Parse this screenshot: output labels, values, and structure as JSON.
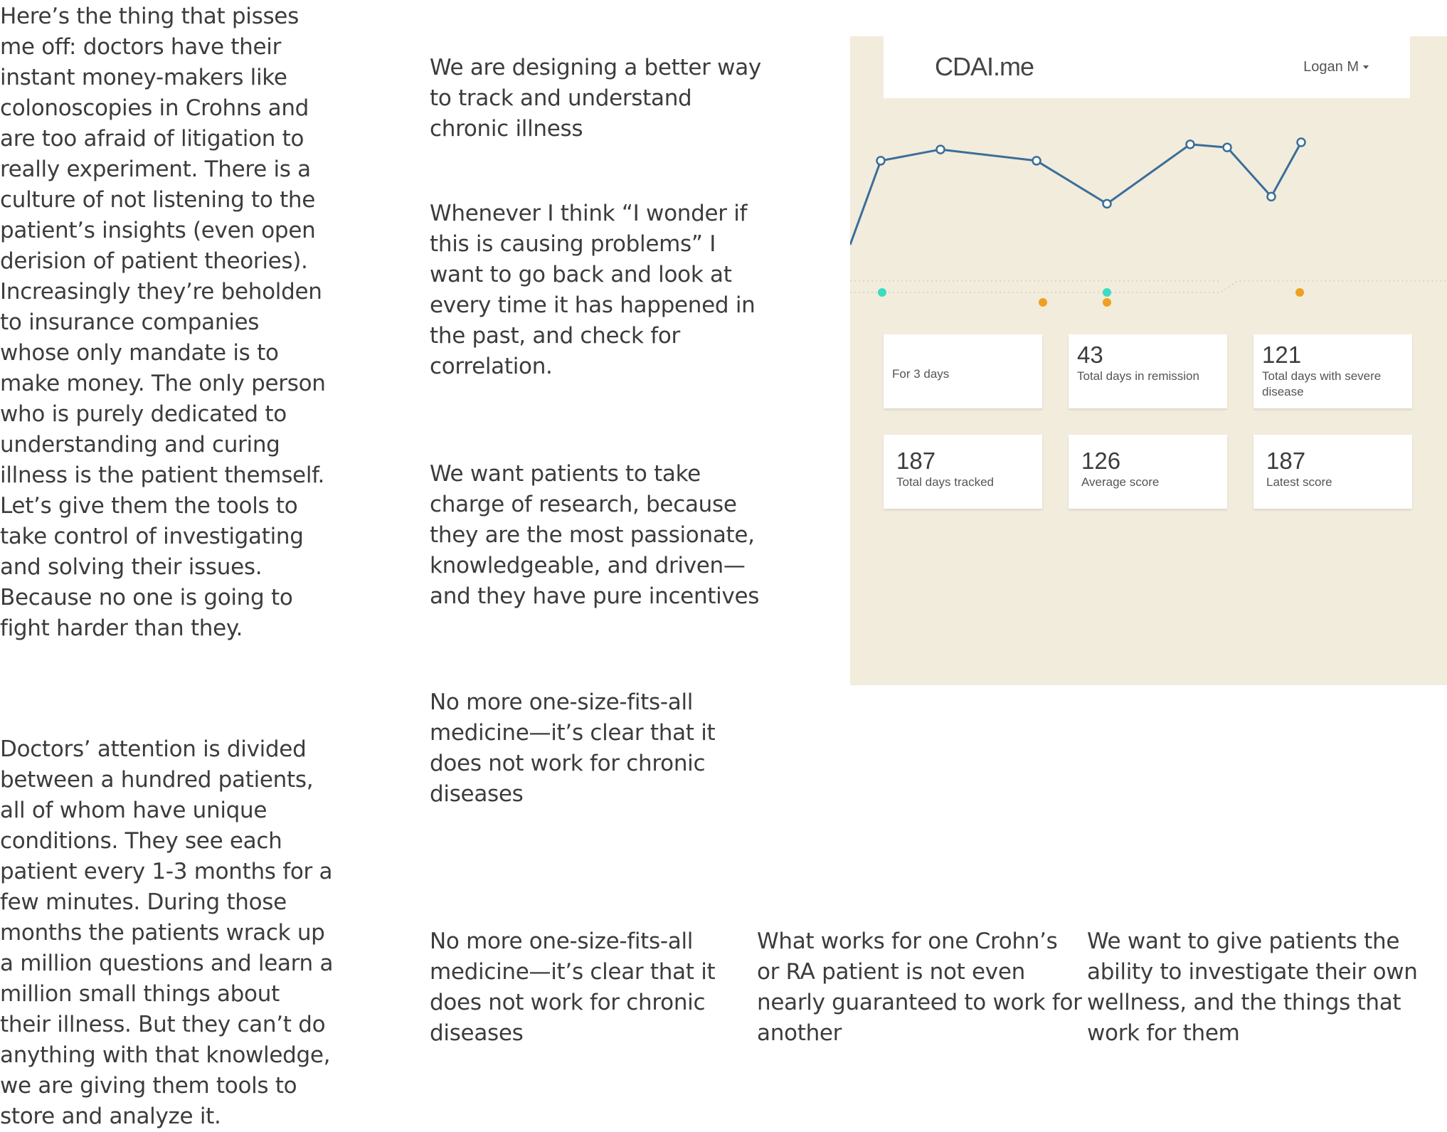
{
  "paragraphs": {
    "left_1": "Here’s the thing that pisses me off: doctors have their instant money-makers like colonoscopies in Crohns and are too afraid of litigation to really experiment. There is a culture of not listening to the patient’s insights (even open derision of patient theories). Increasingly they’re beholden to insurance companies whose only mandate is to make money. The only person who is purely dedicated to understanding and curing illness is the patient themself. Let’s give them the tools to take control of investigating and solving their issues. Because no one is going to fight harder than they.",
    "left_2": "Doctors’ attention is divided between a hundred patients, all of whom have unique conditions. They see each patient every 1-3 months for a few minutes. During those months the patients wrack up a million questions and learn a million small things about their illness. But they can’t do anything with that knowledge, we are giving them tools to store and analyze it.",
    "mid_1": "We are designing a better way to track and understand chronic illness",
    "mid_2": "Whenever I think “I wonder if this is causing problems” I want to go back and look at every time it has happened in the past, and check for correlation.",
    "mid_3": "We want patients to take charge of research, because they are the most passionate, knowledgeable, and driven—and they have pure incentives",
    "mid_4": "No more one-size-fits-all medicine—it’s clear that it does not work for chronic diseases",
    "bottom_1": "No more one-size-fits-all medicine—it’s clear that it does not work for chronic diseases",
    "bottom_2": "What works for one Crohn’s or RA patient is not even nearly guaranteed to work for another",
    "bottom_3": "We want to give patients the ability to investigate their own wellness, and the things that work for them"
  },
  "dashboard": {
    "brand": "CDAI.me",
    "user": "Logan M",
    "colors": {
      "background": "#f2ecdc",
      "line": "#3a6e9a",
      "event_teal": "#3ddbc0",
      "event_orange": "#f0a020"
    },
    "cards": [
      {
        "number": "",
        "label": "For 3 days"
      },
      {
        "number": "43",
        "label": "Total days in remission"
      },
      {
        "number": "121",
        "label": "Total days with severe disease"
      },
      {
        "number": "187",
        "label": "Total days tracked"
      },
      {
        "number": "126",
        "label": "Average score"
      },
      {
        "number": "187",
        "label": "Latest score"
      }
    ]
  },
  "chart_data": {
    "type": "line",
    "title": "",
    "xlabel": "",
    "ylabel": "",
    "x": [
      0,
      1,
      2,
      3,
      4,
      5,
      6,
      7
    ],
    "values": [
      82,
      93,
      82,
      40,
      98,
      95,
      47,
      100
    ],
    "leading_value": 0,
    "ylim": [
      0,
      100
    ],
    "grid": false,
    "events": [
      {
        "x": 0,
        "row": "teal"
      },
      {
        "x": 2,
        "row": "orange"
      },
      {
        "x": 3,
        "row": "teal"
      },
      {
        "x": 3,
        "row": "orange"
      },
      {
        "x": 7,
        "row": "orange"
      }
    ]
  }
}
